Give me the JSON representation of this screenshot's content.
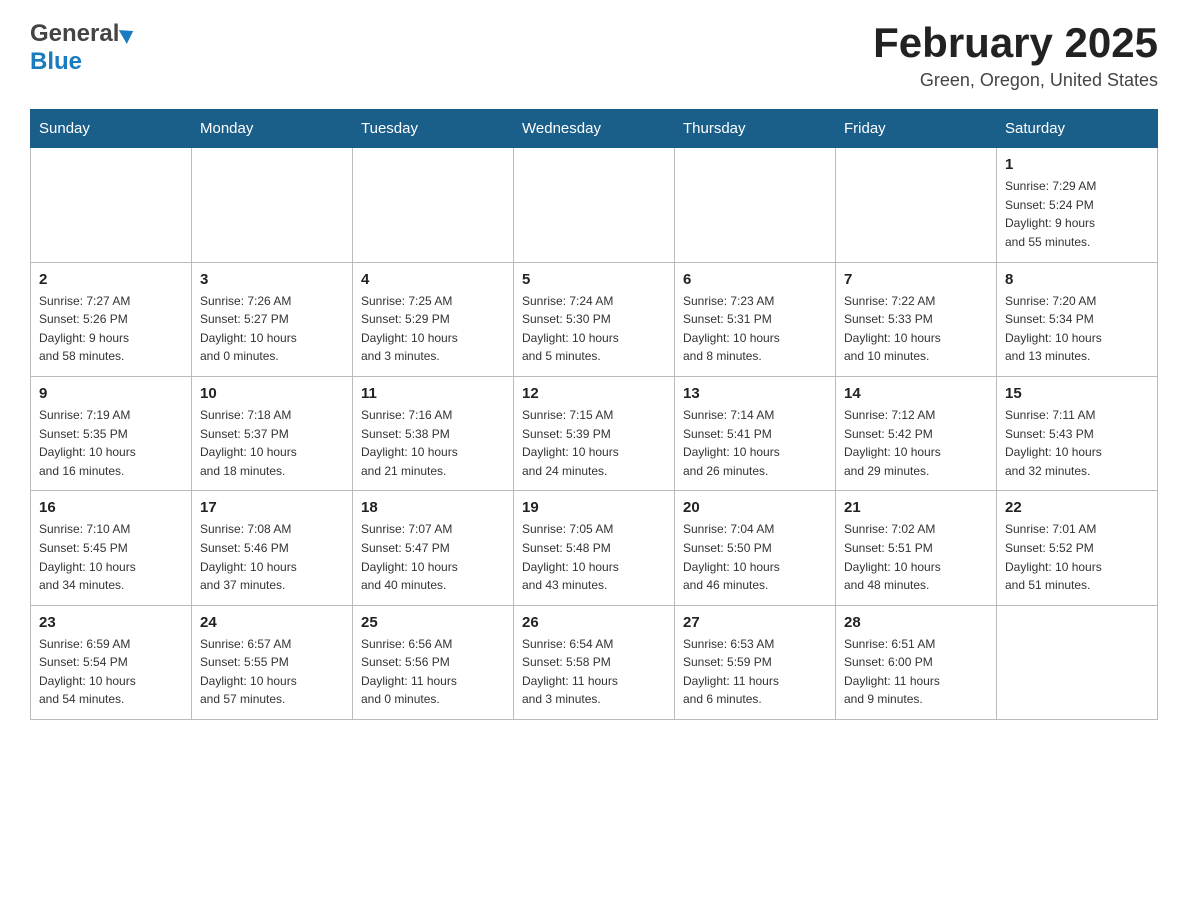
{
  "header": {
    "logo_general": "General",
    "logo_blue": "Blue",
    "title": "February 2025",
    "location": "Green, Oregon, United States"
  },
  "days_of_week": [
    "Sunday",
    "Monday",
    "Tuesday",
    "Wednesday",
    "Thursday",
    "Friday",
    "Saturday"
  ],
  "weeks": [
    [
      {
        "day": "",
        "info": ""
      },
      {
        "day": "",
        "info": ""
      },
      {
        "day": "",
        "info": ""
      },
      {
        "day": "",
        "info": ""
      },
      {
        "day": "",
        "info": ""
      },
      {
        "day": "",
        "info": ""
      },
      {
        "day": "1",
        "info": "Sunrise: 7:29 AM\nSunset: 5:24 PM\nDaylight: 9 hours\nand 55 minutes."
      }
    ],
    [
      {
        "day": "2",
        "info": "Sunrise: 7:27 AM\nSunset: 5:26 PM\nDaylight: 9 hours\nand 58 minutes."
      },
      {
        "day": "3",
        "info": "Sunrise: 7:26 AM\nSunset: 5:27 PM\nDaylight: 10 hours\nand 0 minutes."
      },
      {
        "day": "4",
        "info": "Sunrise: 7:25 AM\nSunset: 5:29 PM\nDaylight: 10 hours\nand 3 minutes."
      },
      {
        "day": "5",
        "info": "Sunrise: 7:24 AM\nSunset: 5:30 PM\nDaylight: 10 hours\nand 5 minutes."
      },
      {
        "day": "6",
        "info": "Sunrise: 7:23 AM\nSunset: 5:31 PM\nDaylight: 10 hours\nand 8 minutes."
      },
      {
        "day": "7",
        "info": "Sunrise: 7:22 AM\nSunset: 5:33 PM\nDaylight: 10 hours\nand 10 minutes."
      },
      {
        "day": "8",
        "info": "Sunrise: 7:20 AM\nSunset: 5:34 PM\nDaylight: 10 hours\nand 13 minutes."
      }
    ],
    [
      {
        "day": "9",
        "info": "Sunrise: 7:19 AM\nSunset: 5:35 PM\nDaylight: 10 hours\nand 16 minutes."
      },
      {
        "day": "10",
        "info": "Sunrise: 7:18 AM\nSunset: 5:37 PM\nDaylight: 10 hours\nand 18 minutes."
      },
      {
        "day": "11",
        "info": "Sunrise: 7:16 AM\nSunset: 5:38 PM\nDaylight: 10 hours\nand 21 minutes."
      },
      {
        "day": "12",
        "info": "Sunrise: 7:15 AM\nSunset: 5:39 PM\nDaylight: 10 hours\nand 24 minutes."
      },
      {
        "day": "13",
        "info": "Sunrise: 7:14 AM\nSunset: 5:41 PM\nDaylight: 10 hours\nand 26 minutes."
      },
      {
        "day": "14",
        "info": "Sunrise: 7:12 AM\nSunset: 5:42 PM\nDaylight: 10 hours\nand 29 minutes."
      },
      {
        "day": "15",
        "info": "Sunrise: 7:11 AM\nSunset: 5:43 PM\nDaylight: 10 hours\nand 32 minutes."
      }
    ],
    [
      {
        "day": "16",
        "info": "Sunrise: 7:10 AM\nSunset: 5:45 PM\nDaylight: 10 hours\nand 34 minutes."
      },
      {
        "day": "17",
        "info": "Sunrise: 7:08 AM\nSunset: 5:46 PM\nDaylight: 10 hours\nand 37 minutes."
      },
      {
        "day": "18",
        "info": "Sunrise: 7:07 AM\nSunset: 5:47 PM\nDaylight: 10 hours\nand 40 minutes."
      },
      {
        "day": "19",
        "info": "Sunrise: 7:05 AM\nSunset: 5:48 PM\nDaylight: 10 hours\nand 43 minutes."
      },
      {
        "day": "20",
        "info": "Sunrise: 7:04 AM\nSunset: 5:50 PM\nDaylight: 10 hours\nand 46 minutes."
      },
      {
        "day": "21",
        "info": "Sunrise: 7:02 AM\nSunset: 5:51 PM\nDaylight: 10 hours\nand 48 minutes."
      },
      {
        "day": "22",
        "info": "Sunrise: 7:01 AM\nSunset: 5:52 PM\nDaylight: 10 hours\nand 51 minutes."
      }
    ],
    [
      {
        "day": "23",
        "info": "Sunrise: 6:59 AM\nSunset: 5:54 PM\nDaylight: 10 hours\nand 54 minutes."
      },
      {
        "day": "24",
        "info": "Sunrise: 6:57 AM\nSunset: 5:55 PM\nDaylight: 10 hours\nand 57 minutes."
      },
      {
        "day": "25",
        "info": "Sunrise: 6:56 AM\nSunset: 5:56 PM\nDaylight: 11 hours\nand 0 minutes."
      },
      {
        "day": "26",
        "info": "Sunrise: 6:54 AM\nSunset: 5:58 PM\nDaylight: 11 hours\nand 3 minutes."
      },
      {
        "day": "27",
        "info": "Sunrise: 6:53 AM\nSunset: 5:59 PM\nDaylight: 11 hours\nand 6 minutes."
      },
      {
        "day": "28",
        "info": "Sunrise: 6:51 AM\nSunset: 6:00 PM\nDaylight: 11 hours\nand 9 minutes."
      },
      {
        "day": "",
        "info": ""
      }
    ]
  ]
}
